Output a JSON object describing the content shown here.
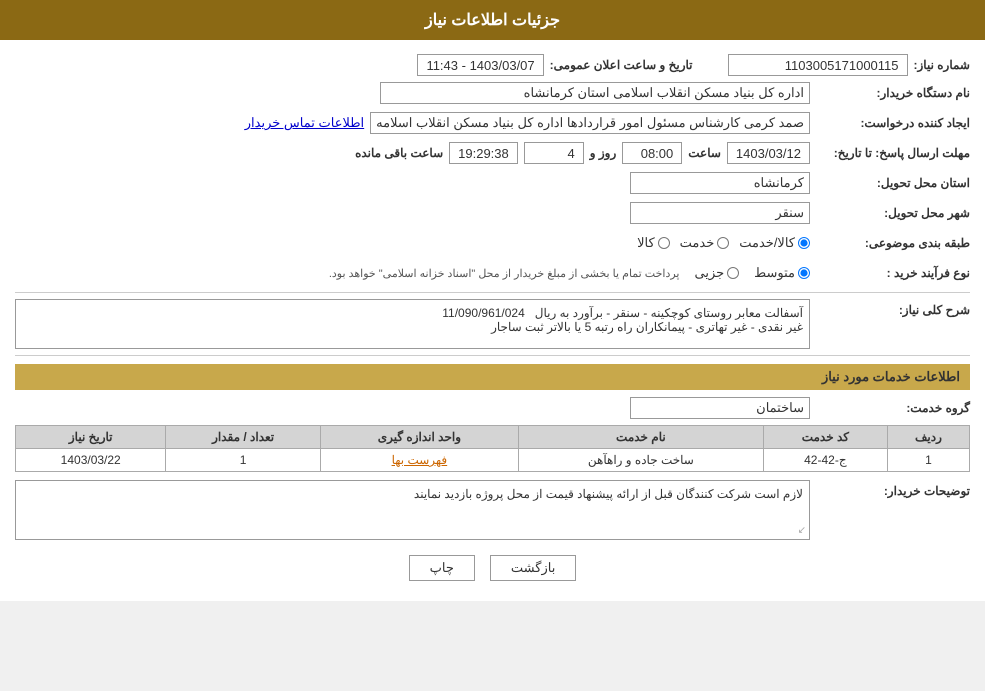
{
  "page": {
    "title": "جزئیات اطلاعات نیاز",
    "sections": {
      "needs_info": "جزئیات اطلاعات نیاز",
      "services_info": "اطلاعات خدمات مورد نیاز"
    }
  },
  "header": {
    "title": "جزئیات اطلاعات نیاز"
  },
  "fields": {
    "need_number_label": "شماره نیاز:",
    "need_number_value": "1103005171000115",
    "announcement_label": "تاریخ و ساعت اعلان عمومی:",
    "announcement_date": "1403/03/07 - 11:43",
    "buyer_org_label": "نام دستگاه خریدار:",
    "buyer_org_value": "اداره کل بنیاد مسکن انقلاب اسلامی استان کرمانشاه",
    "creator_label": "ایجاد کننده درخواست:",
    "creator_value": "",
    "contact_label": "صمد کرمی کارشناس مسئول امور قراردادها اداره کل بنیاد مسکن انقلاب اسلامه",
    "contact_link": "اطلاعات تماس خریدار",
    "deadline_label": "مهلت ارسال پاسخ: تا تاریخ:",
    "deadline_date": "1403/03/12",
    "deadline_time_label": "ساعت",
    "deadline_time": "08:00",
    "deadline_day_label": "روز و",
    "deadline_days": "4",
    "deadline_remaining_label": "ساعت باقی مانده",
    "deadline_remaining": "19:29:38",
    "province_label": "استان محل تحویل:",
    "province_value": "کرمانشاه",
    "city_label": "شهر محل تحویل:",
    "city_value": "سنقر",
    "category_label": "طبقه بندی موضوعی:",
    "category_kala": "کالا",
    "category_khadamat": "خدمت",
    "category_kala_khadamat": "کالا/خدمت",
    "category_selected": "kala_khadamat",
    "process_label": "نوع فرآیند خرید :",
    "process_jozvi": "جزیی",
    "process_motevaset": "متوسط",
    "process_note": "پرداخت تمام یا بخشی از مبلغ خریدار از محل \"اسناد خزانه اسلامی\" خواهد بود.",
    "needs_desc_label": "شرح کلی نیاز:",
    "needs_desc_value": "آسفالت معابر روستای کوچکینه - سنقر - برآورد به ریال  11/090/961/024\nغیر نقدی - غیر تهاتری - پیمانکاران راه رتبه 5 یا بالاتر ثبت ساجار",
    "services_section_label": "اطلاعات خدمات مورد نیاز",
    "service_group_label": "گروه خدمت:",
    "service_group_value": "ساختمان",
    "table_headers": {
      "row_num": "ردیف",
      "service_code": "کد خدمت",
      "service_name": "نام خدمت",
      "unit": "واحد اندازه گیری",
      "quantity": "تعداد / مقدار",
      "date": "تاریخ نیاز"
    },
    "table_rows": [
      {
        "row_num": "1",
        "service_code": "ج-42-42",
        "service_name": "ساخت جاده و راهآهن",
        "unit": "فهرست بها",
        "quantity": "1",
        "date": "1403/03/22"
      }
    ],
    "buyer_comments_label": "توضیحات خریدار:",
    "buyer_comments_value": "لازم است شرکت کنندگان قبل از ارائه پیشنهاد قیمت از محل پروژه بازدید نمایند",
    "btn_print": "چاپ",
    "btn_back": "بازگشت"
  },
  "colors": {
    "header_bg": "#8B6914",
    "section_bg": "#c8a84b",
    "link_color": "#0000cc",
    "unit_link_color": "#cc6600"
  }
}
